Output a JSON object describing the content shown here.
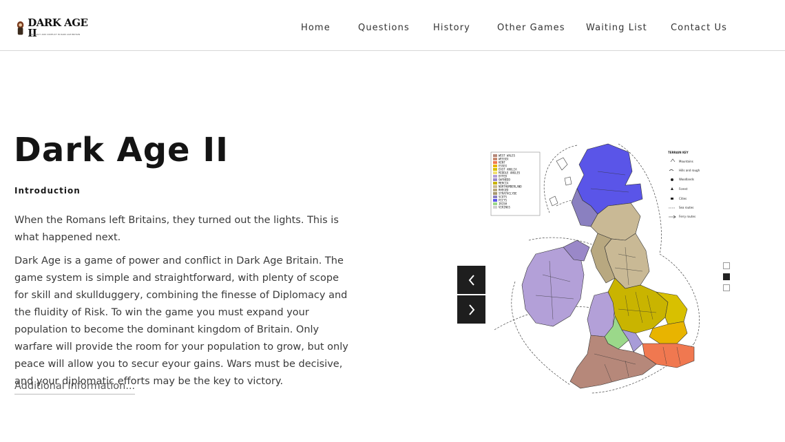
{
  "header": {
    "logo_text": "DARK AGE II",
    "logo_subtitle": "DIPLOMACY AND CONFLICT IN DARK AGE BRITAIN",
    "nav": [
      "Home",
      "Questions",
      "History",
      "Other Games",
      "Waiting List",
      "Contact Us"
    ]
  },
  "main": {
    "title": "Dark Age II",
    "section_label": "Introduction",
    "paragraph1": "When the Romans left Britains, they turned out the lights. This is what happened next.",
    "paragraph2": "Dark Age is a game of power and conflict in Dark Age Britain. The game system is simple and straightforward, with plenty of scope for skill and skullduggery, combining the finesse of Diplomacy and the fluidity of Risk. To win the game you must expand your population to become the dominant kingdom of Britain. Only warfare will provide the room for your population to grow, but only peace will allow you to secur eyour gains. Wars must be decisive, and your diplomatic efforts may be the key to victory.",
    "more_link": "Additional Information..."
  },
  "slider": {
    "active_index": 1,
    "dot_count": 3,
    "icons": {
      "prev": "chevron-left-icon",
      "next": "chevron-right-icon"
    },
    "map": {
      "legend_kingdoms": [
        "WEST WALES",
        "WESSEX",
        "KENT",
        "ESSEX",
        "EAST ANGLIA",
        "MIDDLE ANGLES",
        "DYFED",
        "GWYNEDD",
        "MERCIA",
        "NORTHUMBERLAND",
        "RHEGED",
        "STRATHCLYDE",
        "SCOTS",
        "PICTS",
        "IRISH",
        "VIKINGS"
      ],
      "terrain_key_title": "TERRAIN KEY",
      "terrain_key": [
        "Mountains",
        "Hills and rough",
        "Woodlands",
        "Forest",
        "Cities",
        "Sea routes",
        "Ferry routes"
      ]
    }
  },
  "colors": {
    "text_dark": "#141414",
    "body_text": "#3a3a3a",
    "arrow_bg": "#1e1e1e",
    "map_picts": "#5a55e8",
    "map_ireland": "#b3a0d8",
    "map_north": "#c9b995",
    "map_mercia": "#c9b400",
    "map_wessex": "#b6887a",
    "map_kent": "#f07850"
  }
}
